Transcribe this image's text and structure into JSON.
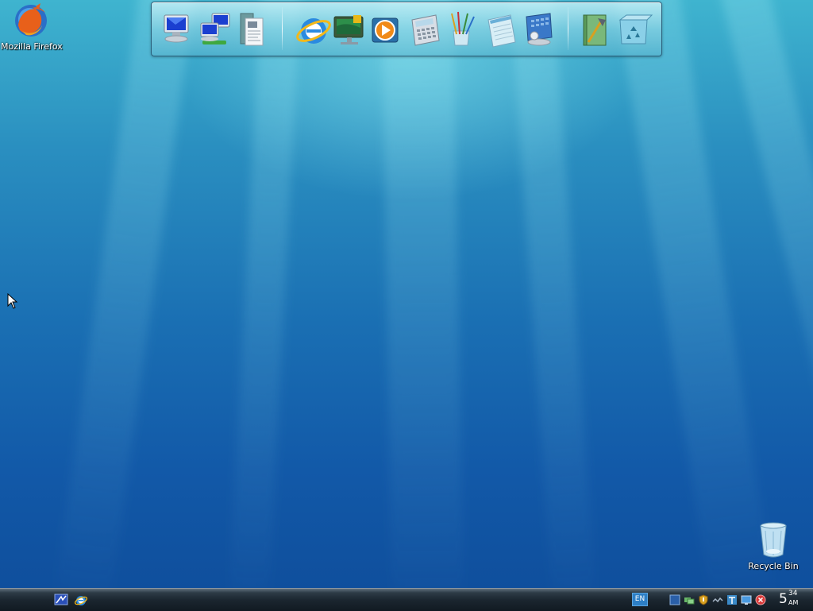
{
  "desktop": {
    "icons": [
      {
        "label": "Mozilla Firefox",
        "icon": "firefox-icon"
      },
      {
        "label": "Recycle Bin",
        "icon": "recycle-bin-icon"
      }
    ]
  },
  "dock": {
    "items": [
      {
        "icon": "computer-icon"
      },
      {
        "icon": "network-icon"
      },
      {
        "icon": "documents-icon"
      },
      {
        "icon": "internet-explorer-icon"
      },
      {
        "icon": "media-center-icon"
      },
      {
        "icon": "media-player-icon"
      },
      {
        "icon": "calculator-icon"
      },
      {
        "icon": "paint-icon"
      },
      {
        "icon": "notepad-icon"
      },
      {
        "icon": "calendar-icon"
      },
      {
        "icon": "tools-icon"
      },
      {
        "icon": "recycle-bin-icon"
      }
    ]
  },
  "taskbar": {
    "quick_launch": [
      {
        "icon": "show-desktop-icon"
      },
      {
        "icon": "internet-explorer-icon"
      }
    ],
    "language": "EN",
    "tray_icons": [
      "display-icon",
      "network-icon",
      "security-shield-icon",
      "connection-icon",
      "text-icon",
      "monitor-icon",
      "close-icon"
    ],
    "clock": {
      "hour": "5",
      "minute": "34",
      "ampm": "AM"
    }
  },
  "colors": {
    "desktop_top": "#3fb4cf",
    "desktop_bottom": "#0f4f9d",
    "taskbar": "#1b2630",
    "language_badge": "#2d7fc6"
  }
}
